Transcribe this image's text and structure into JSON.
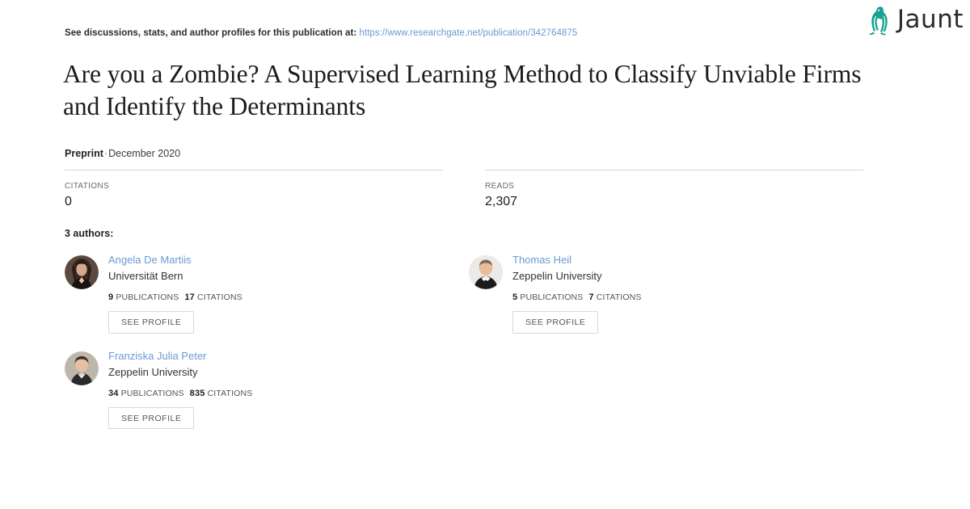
{
  "brand": {
    "name": "Jaunt",
    "accent_color": "#17a093",
    "word_color": "#2b2b2b",
    "icon": "penguin-icon"
  },
  "header": {
    "discussion_prefix": "See discussions, stats, and author profiles for this publication at:",
    "publication_url": "https://www.researchgate.net/publication/342764875"
  },
  "publication": {
    "title": "Are you a Zombie? A Supervised Learning Method to Classify Unviable Firms and Identify the Determinants",
    "type_label": "Preprint",
    "separator": "·",
    "date": "December 2020"
  },
  "metrics": [
    {
      "label": "CITATIONS",
      "value": "0"
    },
    {
      "label": "READS",
      "value": "2,307"
    }
  ],
  "authors_section": {
    "count_label": "3 authors:",
    "see_profile_label": "SEE PROFILE",
    "publications_label": "PUBLICATIONS",
    "citations_label": "CITATIONS",
    "link_color": "#6b9ad1"
  },
  "authors": [
    {
      "name": "Angela De Martiis",
      "affiliation": "Universität Bern",
      "publications": "9",
      "citations": "17",
      "avatar": "avatar-woman-dark-hair"
    },
    {
      "name": "Thomas Heil",
      "affiliation": "Zeppelin University",
      "publications": "5",
      "citations": "7",
      "avatar": "avatar-man-tuxedo"
    },
    {
      "name": "Franziska Julia Peter",
      "affiliation": "Zeppelin University",
      "publications": "34",
      "citations": "835",
      "avatar": "avatar-woman-short-hair"
    }
  ]
}
